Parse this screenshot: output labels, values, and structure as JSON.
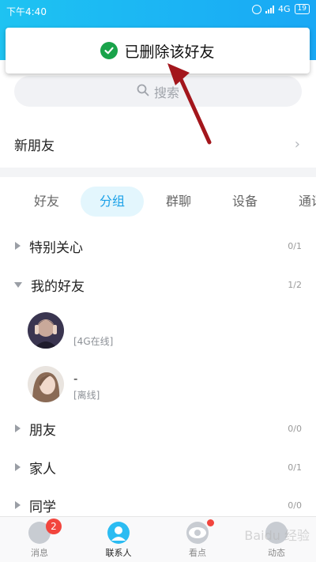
{
  "status_bar": {
    "time": "下午4:40",
    "network": "4G",
    "battery": "19"
  },
  "toast": {
    "text": "已删除该好友",
    "color": "#19a34a"
  },
  "search": {
    "placeholder": "搜索"
  },
  "new_friends": {
    "label": "新朋友"
  },
  "tabs": [
    {
      "label": "好友",
      "active": false
    },
    {
      "label": "分组",
      "active": true
    },
    {
      "label": "群聊",
      "active": false
    },
    {
      "label": "设备",
      "active": false
    },
    {
      "label": "通讯",
      "active": false
    }
  ],
  "groups": [
    {
      "name": "特别关心",
      "count": "0/1",
      "expanded": false
    },
    {
      "name": "我的好友",
      "count": "1/2",
      "expanded": true
    },
    {
      "name": "朋友",
      "count": "0/0",
      "expanded": false
    },
    {
      "name": "家人",
      "count": "0/1",
      "expanded": false
    },
    {
      "name": "同学",
      "count": "0/0",
      "expanded": false
    }
  ],
  "friends": [
    {
      "name": "",
      "status": "[4G在线]"
    },
    {
      "name": "-",
      "status": "[离线]"
    }
  ],
  "nav": [
    {
      "label": "消息",
      "badge": "2"
    },
    {
      "label": "联系人"
    },
    {
      "label": "看点"
    },
    {
      "label": "动态"
    }
  ],
  "accent_color": "#1ec3f2",
  "watermark": "Baidu 经验"
}
